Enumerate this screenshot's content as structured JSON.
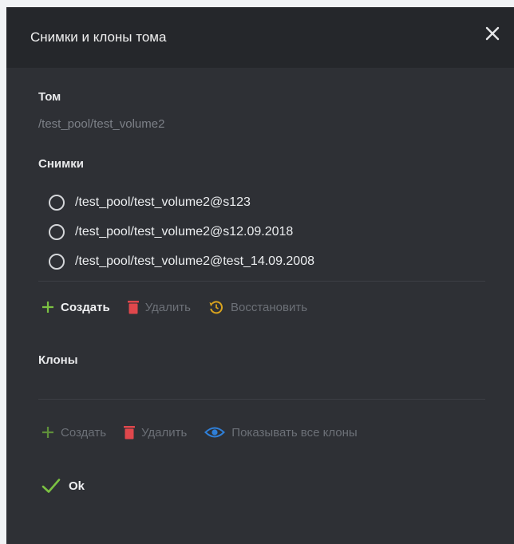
{
  "dialog": {
    "title": "Снимки и клоны тома",
    "volume_section_label": "Том",
    "volume_path": "/test_pool/test_volume2",
    "snapshots_section_label": "Снимки",
    "snapshots": [
      {
        "label": "/test_pool/test_volume2@s123",
        "selected": false
      },
      {
        "label": "/test_pool/test_volume2@s12.09.2018",
        "selected": false
      },
      {
        "label": "/test_pool/test_volume2@test_14.09.2008",
        "selected": false
      }
    ],
    "snapshot_toolbar": {
      "create_label": "Создать",
      "delete_label": "Удалить",
      "restore_label": "Восстановить"
    },
    "clones_section_label": "Клоны",
    "clones": [],
    "clone_toolbar": {
      "create_label": "Создать",
      "delete_label": "Удалить",
      "show_all_label": "Показывать все клоны"
    },
    "ok_label": "Ok"
  },
  "colors": {
    "background": "#2e3035",
    "header": "#25272b",
    "plus_green": "#7bc142",
    "trash_red": "#e0474c",
    "restore_orange": "#d9a31e",
    "eye_blue": "#2f7fd8",
    "check_green": "#7bc142"
  },
  "icons": [
    "close-icon",
    "plus-icon",
    "trash-icon",
    "restore-icon",
    "eye-icon",
    "check-icon"
  ]
}
